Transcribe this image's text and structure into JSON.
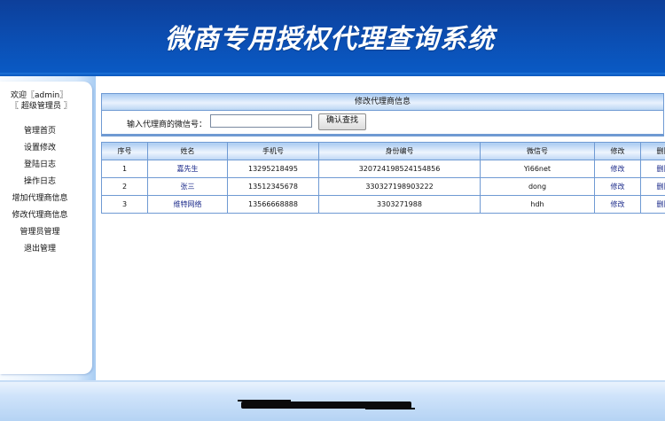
{
  "header": {
    "title": "微商专用授权代理查询系统"
  },
  "sidebar": {
    "welcome_line1": "欢迎〖admin〗",
    "welcome_line2": "〖 超级管理员 〗",
    "items": [
      {
        "label": "管理首页"
      },
      {
        "label": "设置修改"
      },
      {
        "label": "登陆日志"
      },
      {
        "label": "操作日志"
      },
      {
        "label": "增加代理商信息"
      },
      {
        "label": "修改代理商信息"
      },
      {
        "label": "管理员管理"
      },
      {
        "label": "退出管理"
      }
    ]
  },
  "panel": {
    "title": "修改代理商信息",
    "search_label": "输入代理商的微信号：",
    "search_value": "",
    "search_button": "确认查找"
  },
  "table": {
    "columns": [
      "序号",
      "姓名",
      "手机号",
      "身份编号",
      "微信号",
      "修改",
      "删除"
    ],
    "rows": [
      {
        "no": "1",
        "name": "嘉先生",
        "phone": "13295218495",
        "id": "320724198524154856",
        "wechat": "Yi66net",
        "edit": "修改",
        "del": "删除"
      },
      {
        "no": "2",
        "name": "张三",
        "phone": "13512345678",
        "id": "330327198903222",
        "wechat": "dong",
        "edit": "修改",
        "del": "删除"
      },
      {
        "no": "3",
        "name": "维特网络",
        "phone": "13566668888",
        "id": "3303271988",
        "wechat": "hdh",
        "edit": "修改",
        "del": "删除"
      }
    ]
  },
  "colors": {
    "header_blue": "#0b4fb4",
    "border_blue": "#6f9ad3",
    "link": "#1b2a8a"
  }
}
